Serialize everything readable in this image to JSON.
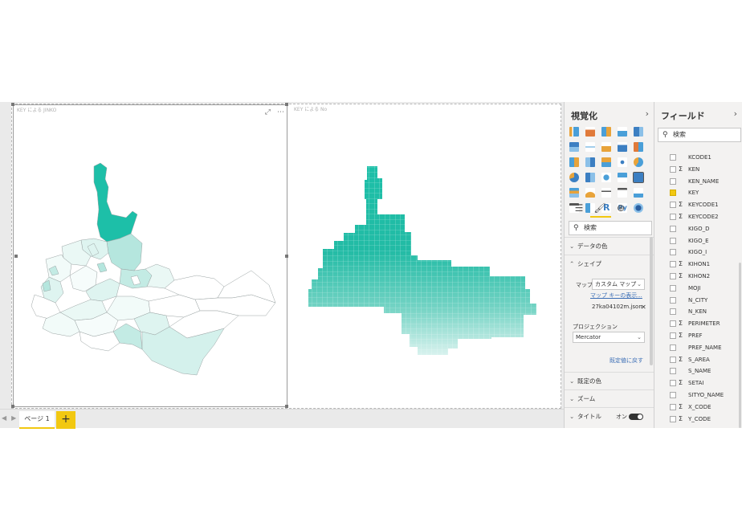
{
  "visuals": [
    {
      "title": "KEY による JINKO",
      "map": "filled_shapes"
    },
    {
      "title": "KEY による No",
      "map": "grid_mesh"
    }
  ],
  "colors": {
    "accent": "#f2c811",
    "map_dark": "#1dbfa8",
    "map_light": "#dff4f1",
    "link": "#3a6db5"
  },
  "pages": {
    "tabs": [
      {
        "label": "ページ 1",
        "active": true
      }
    ],
    "add_label": "+"
  },
  "viz_pane": {
    "title": "視覚化",
    "search_placeholder": "検索",
    "sections": {
      "data_colors": "データの色",
      "shape": "シェイプ",
      "default_colors": "既定の色",
      "zoom": "ズーム",
      "title": "タイトル"
    },
    "shape_settings": {
      "map_label": "マップ",
      "map_value": "カスタム マップ",
      "map_key_link": "マップ キーの表示...",
      "file_name": "27ka04102m.json",
      "projection_label": "プロジェクション",
      "projection_value": "Mercator",
      "reset_link": "既定値に戻す"
    },
    "title_toggle": {
      "label": "オン",
      "on": true
    }
  },
  "fields_pane": {
    "title": "フィールド",
    "search_placeholder": "検索",
    "fields": [
      {
        "name": "KCODE1",
        "sigma": false,
        "checked": false
      },
      {
        "name": "KEN",
        "sigma": true,
        "checked": false
      },
      {
        "name": "KEN_NAME",
        "sigma": false,
        "checked": false
      },
      {
        "name": "KEY",
        "sigma": false,
        "checked": true
      },
      {
        "name": "KEYCODE1",
        "sigma": true,
        "checked": false
      },
      {
        "name": "KEYCODE2",
        "sigma": true,
        "checked": false
      },
      {
        "name": "KIGO_D",
        "sigma": false,
        "checked": false
      },
      {
        "name": "KIGO_E",
        "sigma": false,
        "checked": false
      },
      {
        "name": "KIGO_I",
        "sigma": false,
        "checked": false
      },
      {
        "name": "KIHON1",
        "sigma": true,
        "checked": false
      },
      {
        "name": "KIHON2",
        "sigma": true,
        "checked": false
      },
      {
        "name": "MOJI",
        "sigma": false,
        "checked": false
      },
      {
        "name": "N_CITY",
        "sigma": false,
        "checked": false
      },
      {
        "name": "N_KEN",
        "sigma": false,
        "checked": false
      },
      {
        "name": "PERIMETER",
        "sigma": true,
        "checked": false
      },
      {
        "name": "PREF",
        "sigma": true,
        "checked": false
      },
      {
        "name": "PREF_NAME",
        "sigma": false,
        "checked": false
      },
      {
        "name": "S_AREA",
        "sigma": true,
        "checked": false
      },
      {
        "name": "S_NAME",
        "sigma": false,
        "checked": false
      },
      {
        "name": "SETAI",
        "sigma": true,
        "checked": false
      },
      {
        "name": "SITYO_NAME",
        "sigma": false,
        "checked": false
      },
      {
        "name": "X_CODE",
        "sigma": true,
        "checked": false
      },
      {
        "name": "Y_CODE",
        "sigma": true,
        "checked": false
      }
    ]
  }
}
